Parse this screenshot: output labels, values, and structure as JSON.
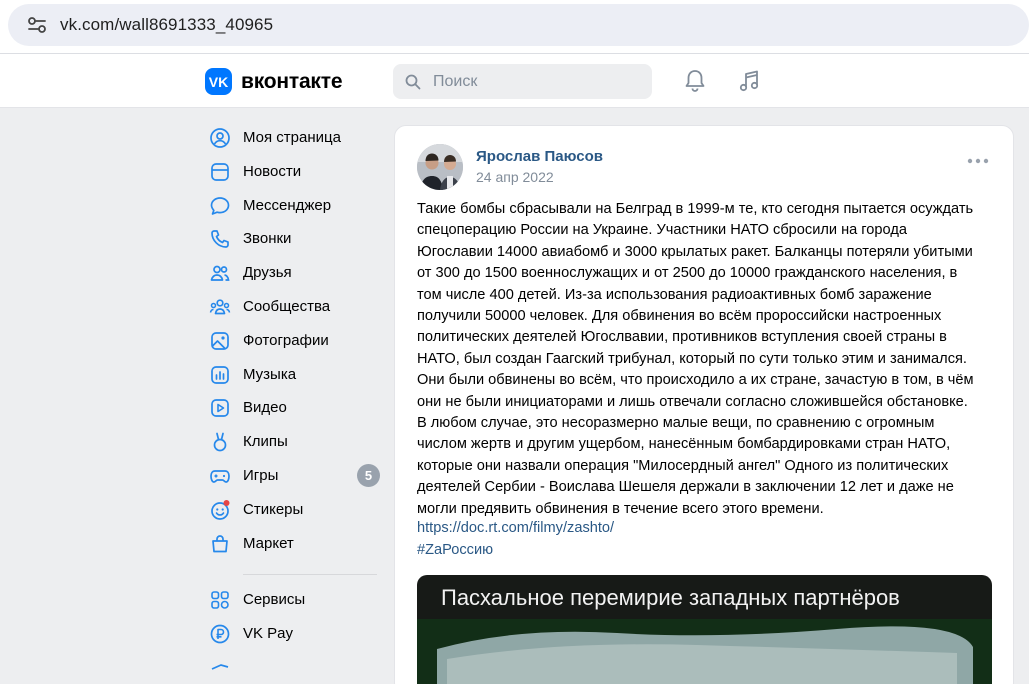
{
  "browser": {
    "url": "vk.com/wall8691333_40965"
  },
  "header": {
    "logo_letter": "VK",
    "logo_text": "вконтакте",
    "search_placeholder": "Поиск"
  },
  "sidebar": {
    "items": [
      {
        "label": "Моя страница",
        "icon": "user-circle-icon"
      },
      {
        "label": "Новости",
        "icon": "newsfeed-icon"
      },
      {
        "label": "Мессенджер",
        "icon": "message-icon"
      },
      {
        "label": "Звонки",
        "icon": "phone-icon"
      },
      {
        "label": "Друзья",
        "icon": "friends-icon"
      },
      {
        "label": "Сообщества",
        "icon": "communities-icon"
      },
      {
        "label": "Фотографии",
        "icon": "photo-icon"
      },
      {
        "label": "Музыка",
        "icon": "music-icon"
      },
      {
        "label": "Видео",
        "icon": "video-icon"
      },
      {
        "label": "Клипы",
        "icon": "clips-icon"
      },
      {
        "label": "Игры",
        "icon": "gamepad-icon",
        "badge": "5"
      },
      {
        "label": "Стикеры",
        "icon": "sticker-icon"
      },
      {
        "label": "Маркет",
        "icon": "market-bag-icon"
      }
    ],
    "extra_items": [
      {
        "label": "Сервисы",
        "icon": "services-icon"
      },
      {
        "label": "VK Pay",
        "icon": "vkpay-icon"
      }
    ]
  },
  "post": {
    "author": "Ярослав Паюсов",
    "date": "24 апр 2022",
    "text_lines": [
      "Такие бомбы сбрасывали на Белград в 1999-м те, кто сегодня пытается осуждать",
      "спецоперацию России на Украине. Участники НАТО сбросили на города",
      "Югославии 14000 авиабомб и 3000 крылатых ракет. Балканцы потеряли убитыми",
      "от 300 до 1500 военнослужащих и от 2500 до 10000 гражданского населения, в",
      "том числе 400 детей. Из-за использования радиоактивных бомб заражение",
      "получили 50000 человек. Для обвинения во всём пророссийски настроенных",
      "политических деятелей Югослвавии, противников вступления своей страны в",
      "НАТО, был создан Гаагский трибунал, который по сути только этим и занимался.",
      "Они были обвинены во всём, что происходило а их стране, зачастую в том, в чём",
      "они не были инициаторами и лишь отвечали согласно сложившейся обстановке.",
      "В любом случае, это несоразмерно малые вещи, по сравнению с огромным",
      "числом жертв и другим ущербом, нанесённым бомбардировками стран НАТО,",
      "которые они назвали операция \"Милосердный ангел\" Одного из политических",
      "деятелей Сербии - Воислава Шешеля держали в заключении 12 лет и даже не",
      "могли предявить обвинения в течение всего этого времени."
    ],
    "link": "https://doc.rt.com/filmy/zashto/",
    "hashtag": "#ZаРоссию",
    "media_caption": "Пасхальное перемирие западных партнёров"
  },
  "colors": {
    "accent": "#0077ff",
    "link": "#2a5885",
    "badge": "#99a2ad",
    "page_bg": "#edeef0"
  }
}
